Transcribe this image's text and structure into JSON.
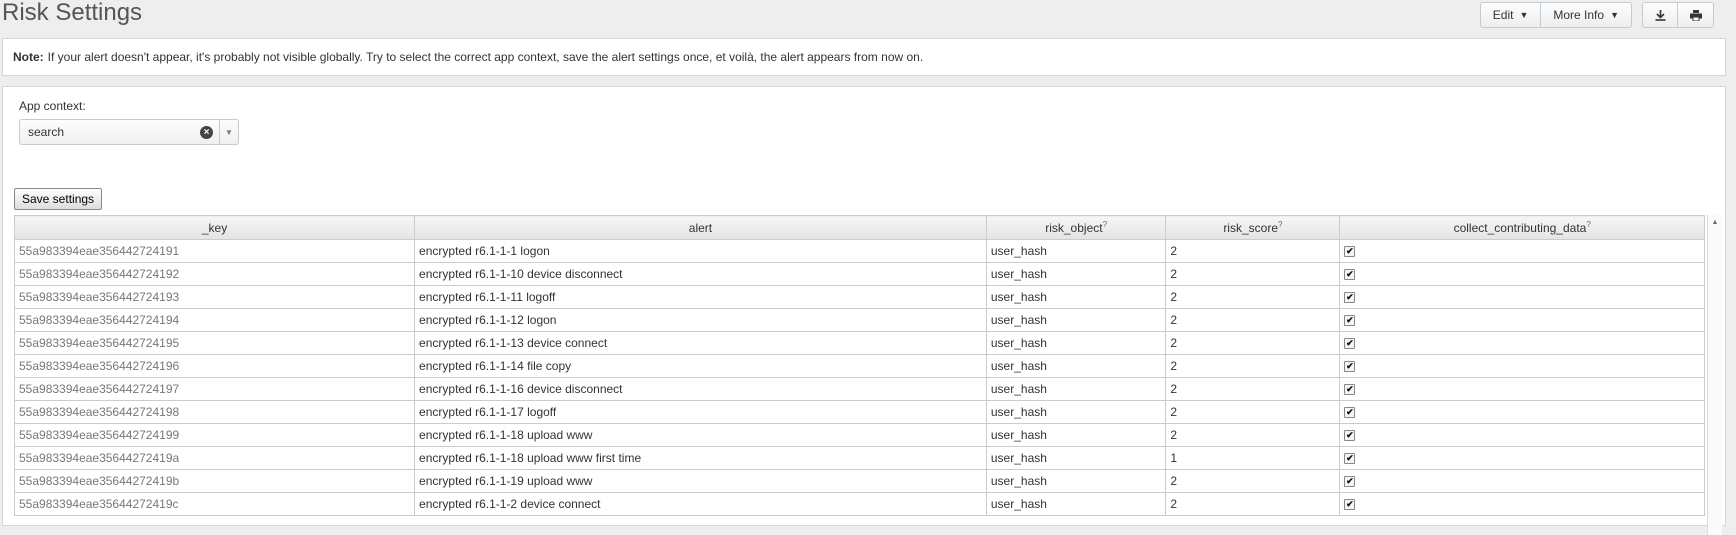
{
  "page": {
    "title": "Risk Settings"
  },
  "toolbar": {
    "edit_label": "Edit",
    "more_info_label": "More Info",
    "download_icon": "download-icon",
    "print_icon": "print-icon"
  },
  "note": {
    "bold": "Note:",
    "text": "If your alert doesn't appear, it's probably not visible globally. Try to select the correct app context, save the alert settings once, et voilà, the alert appears from now on."
  },
  "app_context": {
    "label": "App context:",
    "value": "search"
  },
  "save_button": "Save settings",
  "table": {
    "columns": [
      "_key",
      "alert",
      "risk_object",
      "risk_score",
      "collect_contributing_data"
    ],
    "help_marker": "?",
    "rows": [
      {
        "key": "55a983394eae356442724191",
        "alert": "encrypted r6.1-1-1 logon",
        "risk_object": "user_hash",
        "risk_score": "2",
        "collect": true
      },
      {
        "key": "55a983394eae356442724192",
        "alert": "encrypted r6.1-1-10 device disconnect",
        "risk_object": "user_hash",
        "risk_score": "2",
        "collect": true
      },
      {
        "key": "55a983394eae356442724193",
        "alert": "encrypted r6.1-1-11 logoff",
        "risk_object": "user_hash",
        "risk_score": "2",
        "collect": true
      },
      {
        "key": "55a983394eae356442724194",
        "alert": "encrypted r6.1-1-12 logon",
        "risk_object": "user_hash",
        "risk_score": "2",
        "collect": true
      },
      {
        "key": "55a983394eae356442724195",
        "alert": "encrypted r6.1-1-13 device connect",
        "risk_object": "user_hash",
        "risk_score": "2",
        "collect": true
      },
      {
        "key": "55a983394eae356442724196",
        "alert": "encrypted r6.1-1-14 file copy",
        "risk_object": "user_hash",
        "risk_score": "2",
        "collect": true
      },
      {
        "key": "55a983394eae356442724197",
        "alert": "encrypted r6.1-1-16 device disconnect",
        "risk_object": "user_hash",
        "risk_score": "2",
        "collect": true
      },
      {
        "key": "55a983394eae356442724198",
        "alert": "encrypted r6.1-1-17 logoff",
        "risk_object": "user_hash",
        "risk_score": "2",
        "collect": true
      },
      {
        "key": "55a983394eae356442724199",
        "alert": "encrypted r6.1-1-18 upload www",
        "risk_object": "user_hash",
        "risk_score": "2",
        "collect": true
      },
      {
        "key": "55a983394eae35644272419a",
        "alert": "encrypted r6.1-1-18 upload www first time",
        "risk_object": "user_hash",
        "risk_score": "1",
        "collect": true
      },
      {
        "key": "55a983394eae35644272419b",
        "alert": "encrypted r6.1-1-19 upload www",
        "risk_object": "user_hash",
        "risk_score": "2",
        "collect": true
      },
      {
        "key": "55a983394eae35644272419c",
        "alert": "encrypted r6.1-1-2 device connect",
        "risk_object": "user_hash",
        "risk_score": "2",
        "collect": true
      }
    ]
  }
}
